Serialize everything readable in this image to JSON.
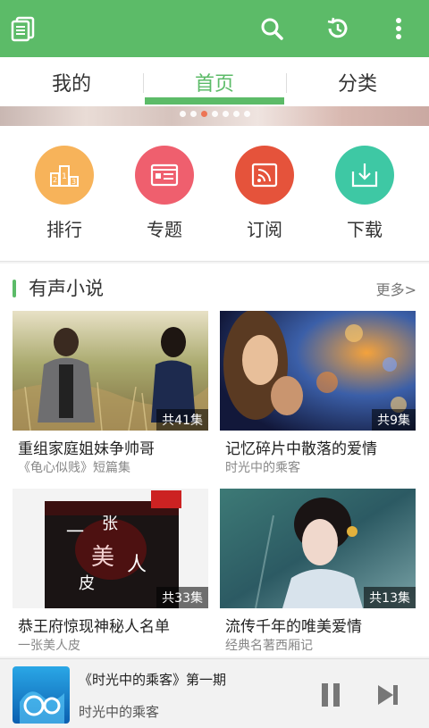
{
  "header": {
    "icons": [
      "library-icon",
      "search-icon",
      "history-icon",
      "more-icon"
    ]
  },
  "tabs": [
    {
      "label": "我的",
      "active": false
    },
    {
      "label": "首页",
      "active": true
    },
    {
      "label": "分类",
      "active": false
    }
  ],
  "banner": {
    "dot_count": 7,
    "active_dot": 3
  },
  "quick_nav": [
    {
      "label": "排行",
      "icon": "ranking-icon",
      "color": "#f7b35a"
    },
    {
      "label": "专题",
      "icon": "topic-icon",
      "color": "#ef5f6e"
    },
    {
      "label": "订阅",
      "icon": "subscribe-icon",
      "color": "#e5533b"
    },
    {
      "label": "下载",
      "icon": "download-icon",
      "color": "#3ec8a4"
    }
  ],
  "section": {
    "title": "有声小说",
    "more": "更多>",
    "cards": [
      {
        "title": "重组家庭姐妹争帅哥",
        "subtitle": "《龟心似贱》短篇集",
        "count": "共41集"
      },
      {
        "title": "记忆碎片中散落的爱情",
        "subtitle": "时光中的乘客",
        "count": "共9集"
      },
      {
        "title": "恭王府惊现神秘人名单",
        "subtitle": "一张美人皮",
        "count": "共33集"
      },
      {
        "title": "流传千年的唯美爱情",
        "subtitle": "经典名著西厢记",
        "count": "共13集"
      }
    ]
  },
  "player": {
    "title": "《时光中的乘客》第一期",
    "subtitle": "时光中的乘客"
  },
  "colors": {
    "brand": "#5cbb68",
    "active_dot": "#ee6a48"
  }
}
